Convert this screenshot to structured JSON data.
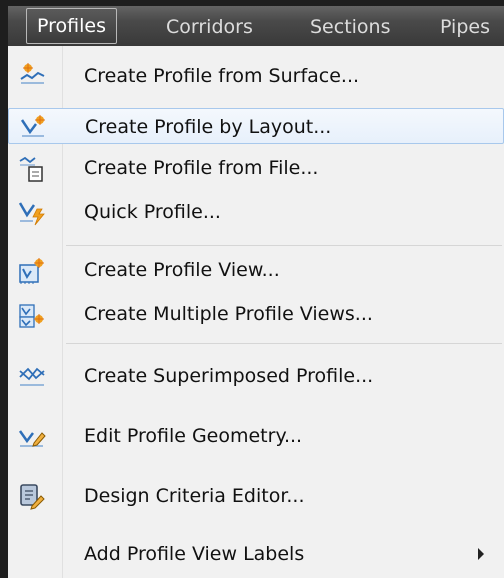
{
  "menubar": {
    "items": [
      {
        "label": "Profiles"
      },
      {
        "label": "Corridors"
      },
      {
        "label": "Sections"
      },
      {
        "label": "Pipes"
      }
    ]
  },
  "dropdown": {
    "items": [
      {
        "label": "Create Profile from Surface...",
        "icon": "profile-from-surface-icon"
      },
      {
        "label": "Create Profile by Layout...",
        "icon": "profile-by-layout-icon"
      },
      {
        "label": "Create Profile from File...",
        "icon": "profile-from-file-icon"
      },
      {
        "label": "Quick Profile...",
        "icon": "quick-profile-icon"
      },
      {
        "label": "Create Profile View...",
        "icon": "profile-view-icon"
      },
      {
        "label": "Create Multiple Profile Views...",
        "icon": "multiple-profile-views-icon"
      },
      {
        "label": "Create Superimposed Profile...",
        "icon": "superimposed-profile-icon"
      },
      {
        "label": "Edit Profile Geometry...",
        "icon": "edit-profile-geometry-icon"
      },
      {
        "label": "Design Criteria Editor...",
        "icon": "design-criteria-editor-icon"
      },
      {
        "label": "Add Profile View Labels",
        "icon": "submenu-arrow-icon"
      }
    ]
  }
}
